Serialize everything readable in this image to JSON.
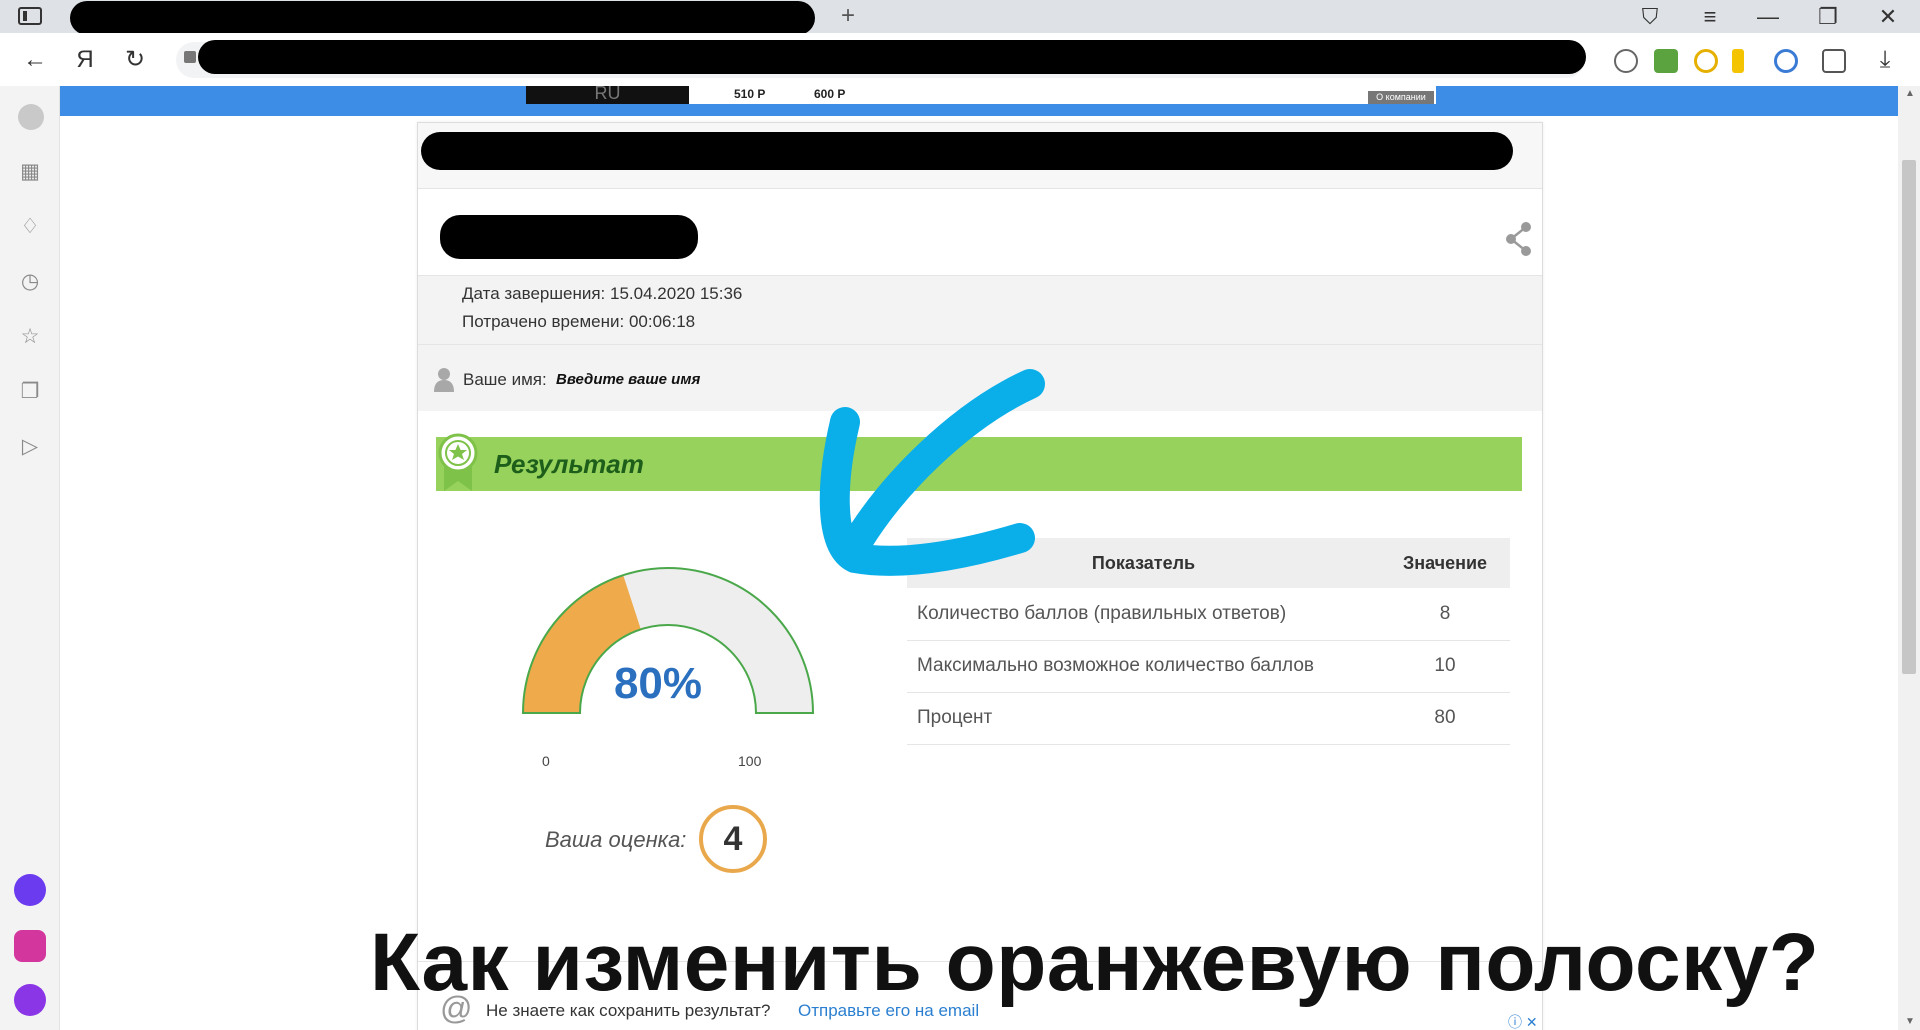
{
  "browser": {
    "new_tab_symbol": "+",
    "nav": {
      "back": "←",
      "yandex": "Я",
      "reload": "↻"
    },
    "window": {
      "bookmarks": "⛉",
      "menu": "≡",
      "minimize": "—",
      "restore": "❐",
      "close": "✕"
    },
    "download": "⤓"
  },
  "ad_strip": {
    "logo_text": "RU",
    "prices": [
      "510 Р",
      "600 Р"
    ],
    "about_label": "О компании"
  },
  "card": {
    "finish_date_label": "Дата завершения:",
    "finish_date_value": "15.04.2020 15:36",
    "time_spent_label": "Потрачено времени:",
    "time_spent_value": "00:06:18",
    "name_label": "Ваше имя:",
    "name_placeholder": "Введите ваше имя",
    "result_title": "Результат",
    "gauge": {
      "percent_text": "80%",
      "value": 80,
      "min_label": "0",
      "max_label": "100",
      "fill_color": "#efab4b",
      "track_color": "#eeeeee",
      "outline_color": "#4aa84a"
    },
    "score_label": "Ваша оценка:",
    "score_value": "4",
    "table": {
      "headers": [
        "Показатель",
        "Значение"
      ],
      "rows": [
        {
          "label": "Количество баллов (правильных ответов)",
          "value": "8"
        },
        {
          "label": "Максимально возможное количество баллов",
          "value": "10"
        },
        {
          "label": "Процент",
          "value": "80"
        }
      ]
    },
    "email_question": "Не знаете как сохранить результат?",
    "email_link": "Отправьте его на email"
  },
  "caption": "Как изменить оранжевую полоску?",
  "colors": {
    "accent_blue": "#3d8de6",
    "result_green": "#97d25c",
    "arrow_cyan": "#0aaee9",
    "score_ring": "#e9a84c"
  }
}
